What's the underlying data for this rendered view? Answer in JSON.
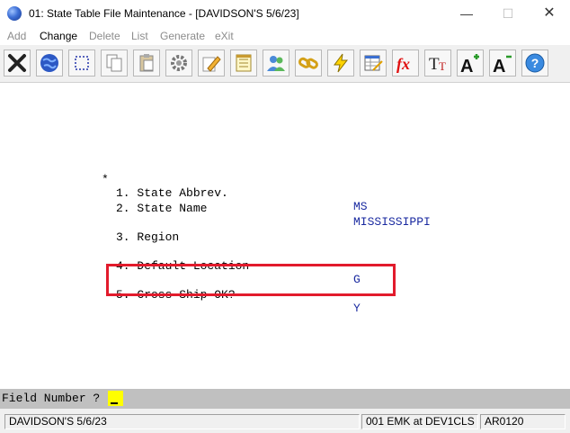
{
  "window": {
    "title": "01: State Table File Maintenance - [DAVIDSON'S 5/6/23]",
    "minimize": "—",
    "maximize": "☐",
    "close": "✕"
  },
  "menu": [
    {
      "label": "Add",
      "active": false
    },
    {
      "label": "Change",
      "active": true
    },
    {
      "label": "Delete",
      "active": false
    },
    {
      "label": "List",
      "active": false
    },
    {
      "label": "Generate",
      "active": false
    },
    {
      "label": "eXit",
      "active": false
    }
  ],
  "toolbar": [
    "close-x-icon",
    "globe-icon",
    "select-box-icon",
    "copy-icon",
    "paste-icon",
    "settings-gear-icon",
    "edit-pencil-icon",
    "notepad-icon",
    "users-icon",
    "chain-link-icon",
    "lightning-icon",
    "spreadsheet-edit-icon",
    "function-fx-icon",
    "text-size-icon",
    "font-increase-icon",
    "font-decrease-icon",
    "help-icon"
  ],
  "fields": [
    {
      "mark": "*",
      "label": "1. State Abbrev.",
      "value": "MS"
    },
    {
      "mark": "",
      "label": "2. State Name",
      "value": "MISSISSIPPI"
    },
    {
      "mark": "",
      "label": "3. Region",
      "value": ""
    },
    {
      "mark": "",
      "label": "4. Default Location",
      "value": "G"
    },
    {
      "mark": "",
      "label": "5. Cross Ship OK?",
      "value": "Y"
    }
  ],
  "prompt": {
    "label": "Field Number ?",
    "value": ""
  },
  "status": {
    "company": "DAVIDSON'S 5/6/23",
    "user": "001 EMK at DEV1CLS",
    "program": "AR0120"
  },
  "colors": {
    "highlight": "#e21b2c",
    "value_text": "#1a2aa0",
    "prompt_bg": "#c0c0c0",
    "input_bg": "#ffff00"
  }
}
